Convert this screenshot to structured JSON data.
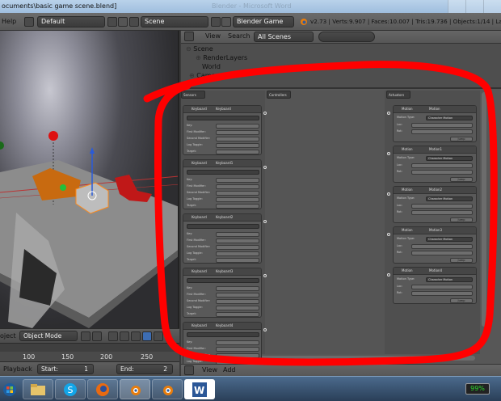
{
  "titlebar": {
    "path": "ocuments\\basic game scene.blend]",
    "ghost": "Blender - Microsoft Word"
  },
  "header": {
    "help": "Help",
    "layout": "Default",
    "scene": "Scene",
    "engine": "Blender Game",
    "stats": "v2.73 | Verts:9.907 | Faces:10.007 | Tris:19.736 | Objects:1/14 | Lampe"
  },
  "outliner": {
    "menu_view": "View",
    "menu_search": "Search",
    "filter": "All Scenes",
    "items": [
      {
        "label": "Scene"
      },
      {
        "label": "RenderLayers"
      },
      {
        "label": "World"
      },
      {
        "label": "Camera"
      }
    ]
  },
  "viewport": {
    "object_label": "oject",
    "mode": "Object Mode"
  },
  "timeline": {
    "ticks": [
      "100",
      "150",
      "200",
      "250"
    ]
  },
  "playback": {
    "label": "Playback",
    "start_label": "Start:",
    "start_value": "1",
    "end_label": "End:",
    "end_value": "2"
  },
  "logic": {
    "menu_view": "View",
    "menu_add": "Add",
    "sensors_title": "Sensors",
    "controllers_title": "Controllers",
    "actuators_title": "Actuators",
    "sensor_bricks": [
      {
        "type": "Keyboard",
        "name": "Keyboard"
      },
      {
        "type": "Keyboard",
        "name": "Keyboard1"
      },
      {
        "type": "Keyboard",
        "name": "Keyboard2"
      },
      {
        "type": "Keyboard",
        "name": "Keyboard3"
      },
      {
        "type": "Keyboard",
        "name": "Keyboard4"
      }
    ],
    "sensor_field_labels": [
      "Key:",
      "First Modifier:",
      "Second Modifier:",
      "Log Toggle:",
      "Target:"
    ],
    "sensor_right_buttons": [
      "All keys",
      "Level",
      "Tap",
      "Invert"
    ],
    "actuator_bricks": [
      {
        "type": "Motion",
        "name": "Motion",
        "motion_type": "Character Motion"
      },
      {
        "type": "Motion",
        "name": "Motion1",
        "motion_type": "Character Motion"
      },
      {
        "type": "Motion",
        "name": "Motion2",
        "motion_type": "Character Motion"
      },
      {
        "type": "Motion",
        "name": "Motion3",
        "motion_type": "Character Motion"
      },
      {
        "type": "Motion",
        "name": "Motion4",
        "motion_type": "Character Motion"
      }
    ],
    "actuator_field_labels": [
      "Motion Type:",
      "Loc:",
      "Rot:"
    ],
    "actuator_jump": "Jump"
  },
  "taskbar": {
    "battery": "99%",
    "icons": [
      "start-orb-icon",
      "folder-icon",
      "skype-icon",
      "firefox-icon",
      "blender-icon",
      "blender-icon",
      "word-icon"
    ]
  },
  "colors": {
    "annotation": "#ff0000",
    "panel": "#575757",
    "header": "#6b6b6b",
    "accent": "#3d6db3",
    "battery_green": "#2bd42b"
  }
}
